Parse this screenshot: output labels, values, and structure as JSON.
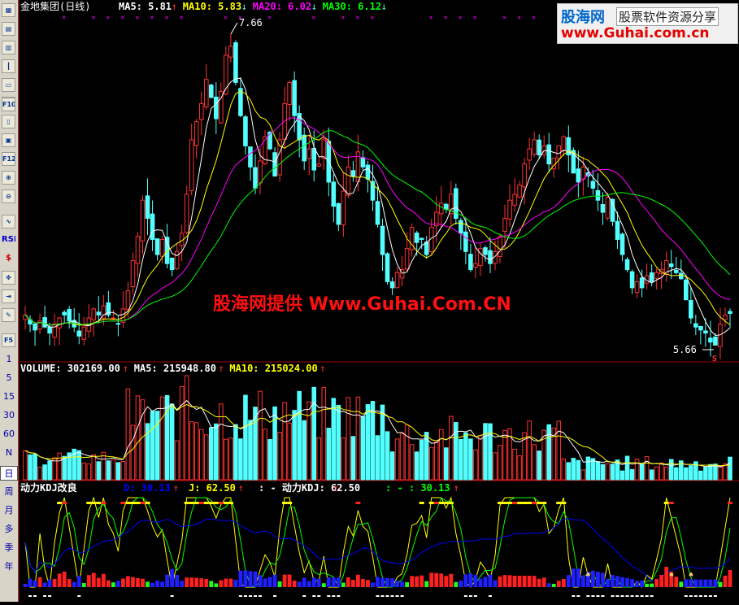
{
  "stock": {
    "name": "金地集团",
    "period": "(日线)"
  },
  "ma_legend": [
    {
      "label": "MA5: 5.81",
      "arrow": "↑",
      "color": "#ffffff"
    },
    {
      "label": "MA10: 5.83",
      "arrow": "↓",
      "color": "#ffff00"
    },
    {
      "label": "MA20: 6.02",
      "arrow": "↓",
      "color": "#ff00ff"
    },
    {
      "label": "MA30: 6.12",
      "arrow": "↓",
      "color": "#00ff00"
    }
  ],
  "price_annotations": {
    "high": "7.66",
    "low": "5.66",
    "s_marker": "S"
  },
  "volume_legend": [
    {
      "label": "VOLUME: 302169.00",
      "arrow": "↑",
      "color": "#ffffff"
    },
    {
      "label": "MA5: 215948.80",
      "arrow": "↑",
      "color": "#ffffff"
    },
    {
      "label": "MA10: 215024.00",
      "arrow": "↑",
      "color": "#ffff00"
    }
  ],
  "kdj_legend": [
    {
      "label": "动力KDJ改良",
      "color": "#ffffff"
    },
    {
      "label": "D: 30.13",
      "arrow": "↑",
      "color": "#0000ff"
    },
    {
      "label": "J: 62.50",
      "arrow": "↑",
      "color": "#ffff00"
    },
    {
      "label": ": - 动力KDJ: 62.50",
      "arrow": "↑",
      "color": "#ffffff"
    },
    {
      "label": ": - : 30.13",
      "arrow": "↑",
      "color": "#00ff00"
    }
  ],
  "watermark": "股海网提供 Www.Guhai.Com.CN",
  "logo": {
    "name": "股海网",
    "tagline": "股票软件资源分享",
    "url": "www.Guhai.com.cn"
  },
  "toolbar": {
    "icon_buttons": [
      "grid-icon",
      "table-icon",
      "bars-icon",
      "candle-icon",
      "screen-icon",
      "list-icon",
      "f10-icon",
      "doc-icon",
      "f11-icon",
      "f12-icon",
      "zoom-in-icon",
      "zoom-out-icon",
      "indicator-icon",
      "rsi-icon",
      "dollar-icon",
      "move-icon",
      "export-icon",
      "pencil-icon",
      "f5-icon"
    ],
    "labels": {
      "f10": "F10",
      "f12": "F12",
      "rsi": "RSI",
      "dollar": "$",
      "f5": "F5"
    },
    "periods": [
      "1",
      "5",
      "15",
      "30",
      "60",
      "N",
      "日",
      "周",
      "月",
      "多",
      "季",
      "年"
    ],
    "selected_period": "日"
  },
  "colors": {
    "up": "#ff3232",
    "down": "#54ffff",
    "ma5": "#ffffff",
    "ma10": "#ffff00",
    "ma20": "#ff00ff",
    "ma30": "#00ff00",
    "kdj_d": "#0000ff",
    "kdj_j": "#ffff00",
    "kdj_k": "#00ff00",
    "grid": "#a00000"
  },
  "chart_data": {
    "type": "candlestick",
    "price_range": [
      5.5,
      7.8
    ],
    "closes": [
      5.8,
      5.74,
      5.7,
      5.76,
      5.72,
      5.68,
      5.74,
      5.78,
      5.8,
      5.76,
      5.72,
      5.66,
      5.72,
      5.78,
      5.84,
      5.8,
      5.86,
      5.8,
      5.78,
      5.74,
      5.84,
      5.96,
      6.16,
      6.32,
      6.56,
      6.44,
      6.3,
      6.2,
      6.3,
      6.14,
      6.1,
      6.22,
      6.34,
      6.6,
      6.96,
      7.08,
      7.2,
      7.36,
      7.24,
      7.1,
      7.28,
      7.52,
      7.58,
      7.34,
      7.12,
      6.92,
      6.78,
      6.64,
      6.82,
      6.98,
      6.9,
      6.72,
      6.96,
      7.2,
      7.34,
      7.12,
      6.96,
      6.82,
      6.9,
      6.76,
      6.8,
      6.96,
      6.68,
      6.52,
      6.4,
      6.62,
      6.78,
      6.72,
      6.88,
      6.78,
      6.7,
      6.56,
      6.4,
      6.2,
      6.02,
      5.98,
      6.08,
      6.1,
      6.24,
      6.38,
      6.28,
      6.3,
      6.2,
      6.38,
      6.48,
      6.54,
      6.5,
      6.6,
      6.44,
      6.34,
      6.22,
      6.1,
      6.14,
      6.24,
      6.2,
      6.14,
      6.22,
      6.32,
      6.44,
      6.56,
      6.6,
      6.66,
      6.8,
      6.9,
      6.96,
      6.86,
      6.92,
      6.8,
      6.84,
      6.92,
      6.98,
      6.86,
      6.74,
      6.68,
      6.78,
      6.72,
      6.64,
      6.56,
      6.48,
      6.58,
      6.42,
      6.3,
      6.2,
      6.1,
      5.98,
      6.02,
      5.98,
      6.06,
      6.02,
      6.08,
      6.1,
      6.16,
      6.12,
      6.08,
      6.04,
      5.9,
      5.78,
      5.72,
      5.7,
      5.68,
      5.62,
      5.6,
      5.74,
      5.8,
      5.81
    ]
  }
}
